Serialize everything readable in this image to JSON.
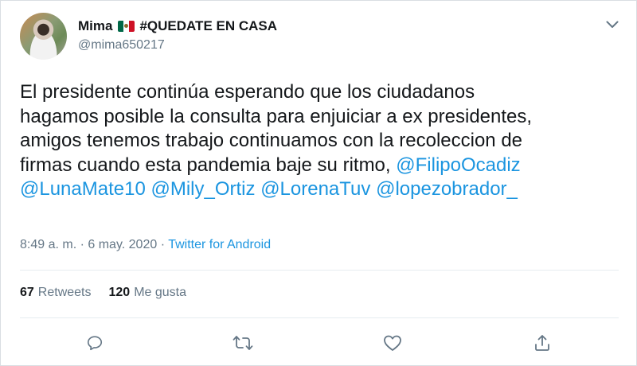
{
  "user": {
    "name": "Mima",
    "flag_icon": "mexico-flag-icon",
    "tag": "#QUEDATE EN CASA",
    "handle": "@mima650217"
  },
  "tweet": {
    "line1": "El presidente continúa esperando que los ciudadanos",
    "line2": "hagamos posible la consulta para enjuiciar a ex presidentes,",
    "line3": "amigos tenemos trabajo  continuamos con la recoleccion de",
    "line4_text": "firmas cuando esta pandemia baje su ritmo, ",
    "mentions": [
      "@FilipoOcadiz",
      "@LunaMate10",
      "@Mily_Ortiz",
      "@LorenaTuv",
      "@lopezobrador_"
    ]
  },
  "meta": {
    "time": "8:49 a. m.",
    "separator": " · ",
    "date": "6 may. 2020",
    "source": "Twitter for Android"
  },
  "stats": {
    "retweets_count": "67",
    "retweets_label": "Retweets",
    "likes_count": "120",
    "likes_label": "Me gusta"
  },
  "actions": [
    "reply-icon",
    "retweet-icon",
    "like-icon",
    "share-icon"
  ],
  "colors": {
    "link": "#1b95e0",
    "secondary_text": "#657786",
    "primary_text": "#14171a",
    "divider": "#e6ecf0"
  }
}
